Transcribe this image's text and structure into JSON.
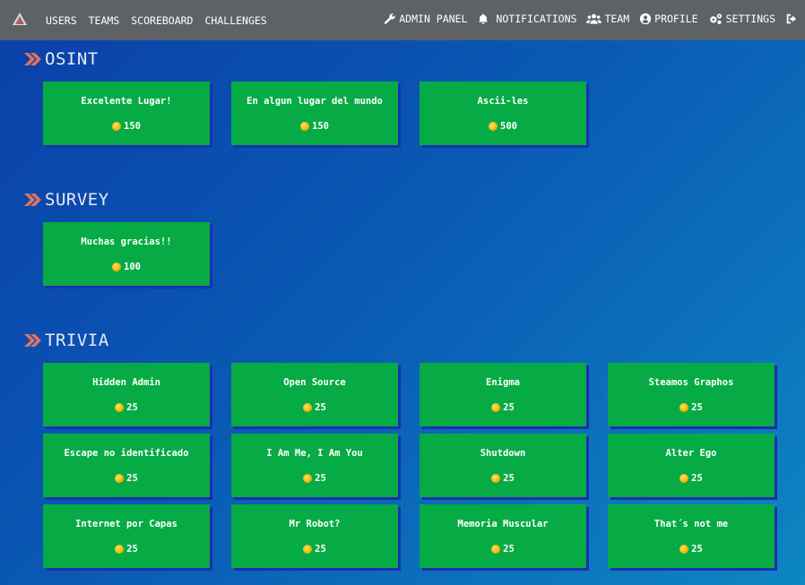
{
  "nav": {
    "left": [
      "USERS",
      "TEAMS",
      "SCOREBOARD",
      "CHALLENGES"
    ],
    "admin": "ADMIN PANEL",
    "notifications": "NOTIFICATIONS",
    "team": "TEAM",
    "profile": "PROFILE",
    "settings": "SETTINGS"
  },
  "colors": {
    "card": "#06ab45",
    "navbar": "#5f6264",
    "chevron": "#e0735e"
  },
  "categories": [
    {
      "name": "OSINT",
      "challenges": [
        {
          "name": "Excelente Lugar!",
          "points": "150"
        },
        {
          "name": "En algun lugar del mundo",
          "points": "150"
        },
        {
          "name": "Ascii-les",
          "points": "500"
        }
      ]
    },
    {
      "name": "SURVEY",
      "challenges": [
        {
          "name": "Muchas gracias!!",
          "points": "100"
        }
      ]
    },
    {
      "name": "TRIVIA",
      "challenges": [
        {
          "name": "Hidden Admin",
          "points": "25"
        },
        {
          "name": "Open Source",
          "points": "25"
        },
        {
          "name": "Enigma",
          "points": "25"
        },
        {
          "name": "Steamos Graphos",
          "points": "25"
        },
        {
          "name": "Escape no identificado",
          "points": "25"
        },
        {
          "name": "I Am Me, I Am You",
          "points": "25"
        },
        {
          "name": "Shutdown",
          "points": "25"
        },
        {
          "name": "Alter Ego",
          "points": "25"
        },
        {
          "name": "Internet por Capas",
          "points": "25"
        },
        {
          "name": "Mr Robot?",
          "points": "25"
        },
        {
          "name": "Memoria Muscular",
          "points": "25"
        },
        {
          "name": "That´s not me",
          "points": "25"
        }
      ]
    }
  ]
}
